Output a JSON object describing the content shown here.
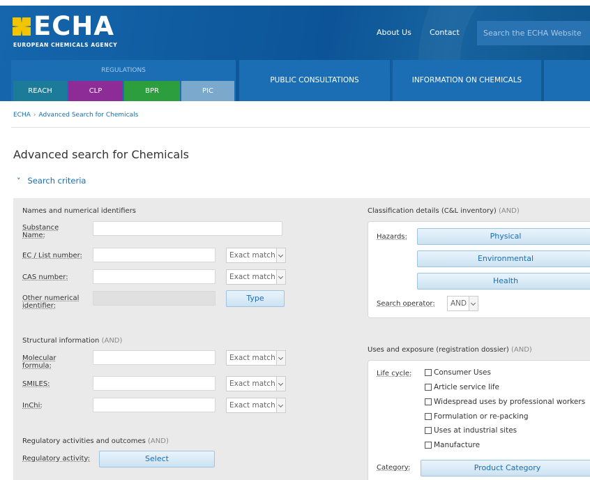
{
  "header": {
    "logo_text": "ECHA",
    "logo_subtitle": "EUROPEAN CHEMICALS AGENCY",
    "about": "About Us",
    "contact": "Contact",
    "search_placeholder": "Search the ECHA Website",
    "regulations_label": "REGULATIONS",
    "reg_tabs": [
      {
        "label": "REACH",
        "color": "#1d7b9a"
      },
      {
        "label": "CLP",
        "color": "#8e2c97"
      },
      {
        "label": "BPR",
        "color": "#2c9e3e"
      },
      {
        "label": "PIC",
        "color": "#7ba9cd"
      }
    ],
    "nav": [
      "PUBLIC CONSULTATIONS",
      "INFORMATION ON CHEMICALS"
    ]
  },
  "breadcrumb": {
    "home": "ECHA",
    "current": "Advanced Search for Chemicals"
  },
  "page_title": "Advanced search for Chemicals",
  "search_criteria": "Search criteria",
  "names": {
    "title": "Names and numerical identifiers",
    "substance_name": "Substance Name:",
    "ec_number": "EC / List number:",
    "cas_number": "CAS number:",
    "other_identifier": "Other numerical identifier:",
    "match": "Exact match",
    "type_button": "Type"
  },
  "structural": {
    "title": "Structural information",
    "and": "(AND)",
    "molecular_formula": "Molecular formula:",
    "smiles": "SMILES:",
    "inchi": "InChi:",
    "match": "Exact match"
  },
  "regulatory": {
    "title": "Regulatory activities and outcomes",
    "and": "(AND)",
    "activity_label": "Regulatory activity:",
    "select_button": "Select"
  },
  "classification": {
    "title": "Classification details (C&L inventory)",
    "and": "(AND)",
    "hazards_label": "Hazards:",
    "physical": "Physical",
    "environmental": "Environmental",
    "health": "Health",
    "operator_label": "Search operator:",
    "operator_value": "AND"
  },
  "uses": {
    "title": "Uses and exposure (registration dossier)",
    "and": "(AND)",
    "life_cycle_label": "Life cycle:",
    "life_cycle": [
      "Consumer Uses",
      "Article service life",
      "Widespread uses by professional workers",
      "Formulation or re-packing",
      "Uses at industrial sites",
      "Manufacture"
    ],
    "category_label": "Category:",
    "category_button": "Product Category"
  }
}
